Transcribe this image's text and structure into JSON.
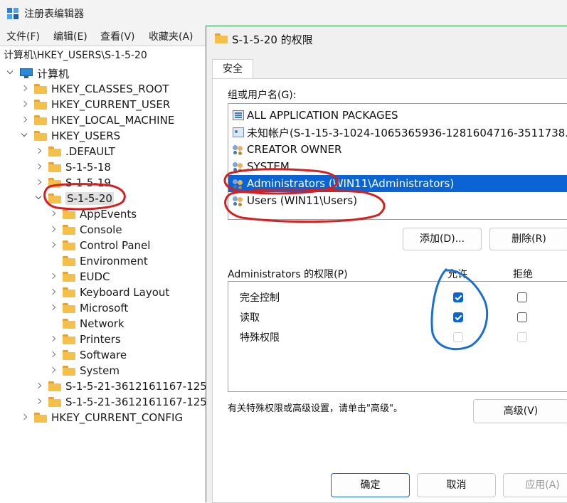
{
  "regedit": {
    "title": "注册表编辑器",
    "menu": [
      "文件(F)",
      "编辑(E)",
      "查看(V)",
      "收藏夹(A)"
    ],
    "address": "计算机\\HKEY_USERS\\S-1-5-20",
    "tree": [
      {
        "label": "计算机",
        "depth": 0,
        "expander": "down",
        "icon": "computer-icon"
      },
      {
        "label": "HKEY_CLASSES_ROOT",
        "depth": 1,
        "expander": "right",
        "icon": "folder-icon"
      },
      {
        "label": "HKEY_CURRENT_USER",
        "depth": 1,
        "expander": "right",
        "icon": "folder-icon"
      },
      {
        "label": "HKEY_LOCAL_MACHINE",
        "depth": 1,
        "expander": "right",
        "icon": "folder-icon"
      },
      {
        "label": "HKEY_USERS",
        "depth": 1,
        "expander": "down",
        "icon": "folder-icon"
      },
      {
        "label": ".DEFAULT",
        "depth": 2,
        "expander": "right",
        "icon": "folder-icon"
      },
      {
        "label": "S-1-5-18",
        "depth": 2,
        "expander": "right",
        "icon": "folder-icon"
      },
      {
        "label": "S-1-5-19",
        "depth": 2,
        "expander": "right",
        "icon": "folder-icon"
      },
      {
        "label": "S-1-5-20",
        "depth": 2,
        "expander": "down",
        "icon": "folder-icon",
        "selected": true
      },
      {
        "label": "AppEvents",
        "depth": 3,
        "expander": "right",
        "icon": "folder-icon"
      },
      {
        "label": "Console",
        "depth": 3,
        "expander": "right",
        "icon": "folder-icon"
      },
      {
        "label": "Control Panel",
        "depth": 3,
        "expander": "right",
        "icon": "folder-icon"
      },
      {
        "label": "Environment",
        "depth": 3,
        "expander": "none",
        "icon": "folder-icon"
      },
      {
        "label": "EUDC",
        "depth": 3,
        "expander": "right",
        "icon": "folder-icon"
      },
      {
        "label": "Keyboard Layout",
        "depth": 3,
        "expander": "right",
        "icon": "folder-icon"
      },
      {
        "label": "Microsoft",
        "depth": 3,
        "expander": "right",
        "icon": "folder-icon"
      },
      {
        "label": "Network",
        "depth": 3,
        "expander": "none",
        "icon": "folder-icon"
      },
      {
        "label": "Printers",
        "depth": 3,
        "expander": "right",
        "icon": "folder-icon"
      },
      {
        "label": "Software",
        "depth": 3,
        "expander": "right",
        "icon": "folder-icon"
      },
      {
        "label": "System",
        "depth": 3,
        "expander": "right",
        "icon": "folder-icon"
      },
      {
        "label": "S-1-5-21-3612161167-1255",
        "depth": 2,
        "expander": "right",
        "icon": "folder-icon"
      },
      {
        "label": "S-1-5-21-3612161167-1255",
        "depth": 2,
        "expander": "right",
        "icon": "folder-icon"
      },
      {
        "label": "HKEY_CURRENT_CONFIG",
        "depth": 1,
        "expander": "right",
        "icon": "folder-icon"
      }
    ]
  },
  "dialog": {
    "title": "S-1-5-20 的权限",
    "tab": "安全",
    "group_label": "组或用户名(G):",
    "users": [
      {
        "name": "ALL APPLICATION PACKAGES",
        "icon": "package-icon"
      },
      {
        "name": "未知帐户(S-1-15-3-1024-1065365936-1281604716-3511738...",
        "icon": "account-icon"
      },
      {
        "name": "CREATOR OWNER",
        "icon": "group-icon"
      },
      {
        "name": "SYSTEM",
        "icon": "group-icon"
      },
      {
        "name": "Administrators (WIN11\\Administrators)",
        "icon": "group-icon",
        "selected": true
      },
      {
        "name": "Users (WIN11\\Users)",
        "icon": "group-icon"
      }
    ],
    "add_button": "添加(D)...",
    "remove_button": "删除(R)",
    "perm_label": "Administrators 的权限(P)",
    "allow_header": "允许",
    "deny_header": "拒绝",
    "permissions": [
      {
        "name": "完全控制",
        "allow": true,
        "deny": false,
        "enabled": true
      },
      {
        "name": "读取",
        "allow": true,
        "deny": false,
        "enabled": true
      },
      {
        "name": "特殊权限",
        "allow": false,
        "deny": false,
        "enabled": false
      }
    ],
    "advanced_hint": "有关特殊权限或高级设置，请单击\"高级\"。",
    "advanced_button": "高级(V)",
    "ok_button": "确定",
    "cancel_button": "取消",
    "apply_button": "应用(A)"
  },
  "colors": {
    "selection": "#0a64d4",
    "dialog_border": "#1c8a3c",
    "annotation_red": "#d42020",
    "annotation_blue": "#1a6fd0"
  }
}
